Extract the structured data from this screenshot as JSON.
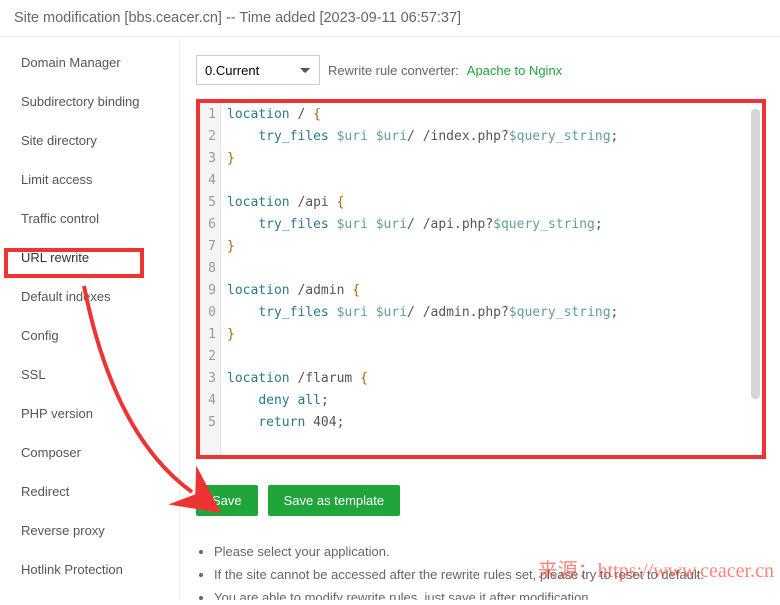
{
  "header": {
    "title": "Site modification [bbs.ceacer.cn] -- Time added [2023-09-11 06:57:37]"
  },
  "sidebar": {
    "items": [
      {
        "label": "Domain Manager"
      },
      {
        "label": "Subdirectory binding"
      },
      {
        "label": "Site directory"
      },
      {
        "label": "Limit access"
      },
      {
        "label": "Traffic control"
      },
      {
        "label": "URL rewrite"
      },
      {
        "label": "Default indexes"
      },
      {
        "label": "Config"
      },
      {
        "label": "SSL"
      },
      {
        "label": "PHP version"
      },
      {
        "label": "Composer"
      },
      {
        "label": "Redirect"
      },
      {
        "label": "Reverse proxy"
      },
      {
        "label": "Hotlink Protection"
      }
    ]
  },
  "dropdown": {
    "value": "0.Current"
  },
  "converter": {
    "label": "Rewrite rule converter: ",
    "link": "Apache to Nginx"
  },
  "code": {
    "lines": [
      {
        "n": "1",
        "raw": "location / {",
        "seg": [
          [
            "kw",
            "location"
          ],
          [
            "",
            " / "
          ],
          [
            "brace",
            "{"
          ]
        ]
      },
      {
        "n": "2",
        "raw": "    try_files $uri $uri/ /index.php?$query_string;",
        "seg": [
          [
            "",
            "    "
          ],
          [
            "kw",
            "try_files"
          ],
          [
            "",
            " "
          ],
          [
            "var",
            "$uri"
          ],
          [
            "",
            " "
          ],
          [
            "var",
            "$uri"
          ],
          [
            "",
            "/ /index.php?"
          ],
          [
            "var",
            "$query_string"
          ],
          [
            "",
            ";"
          ]
        ]
      },
      {
        "n": "3",
        "raw": "}",
        "seg": [
          [
            "brace",
            "}"
          ]
        ]
      },
      {
        "n": "4",
        "raw": "",
        "seg": [
          [
            "",
            ""
          ]
        ]
      },
      {
        "n": "5",
        "raw": "location /api {",
        "seg": [
          [
            "kw",
            "location"
          ],
          [
            "",
            " /api "
          ],
          [
            "brace",
            "{"
          ]
        ]
      },
      {
        "n": "6",
        "raw": "    try_files $uri $uri/ /api.php?$query_string;",
        "seg": [
          [
            "",
            "    "
          ],
          [
            "kw",
            "try_files"
          ],
          [
            "",
            " "
          ],
          [
            "var",
            "$uri"
          ],
          [
            "",
            " "
          ],
          [
            "var",
            "$uri"
          ],
          [
            "",
            "/ /api.php?"
          ],
          [
            "var",
            "$query_string"
          ],
          [
            "",
            ";"
          ]
        ]
      },
      {
        "n": "7",
        "raw": "}",
        "seg": [
          [
            "brace",
            "}"
          ]
        ]
      },
      {
        "n": "8",
        "raw": "",
        "seg": [
          [
            "",
            ""
          ]
        ]
      },
      {
        "n": "9",
        "raw": "location /admin {",
        "seg": [
          [
            "kw",
            "location"
          ],
          [
            "",
            " /admin "
          ],
          [
            "brace",
            "{"
          ]
        ]
      },
      {
        "n": "0",
        "raw": "    try_files $uri $uri/ /admin.php?$query_string;",
        "seg": [
          [
            "",
            "    "
          ],
          [
            "kw",
            "try_files"
          ],
          [
            "",
            " "
          ],
          [
            "var",
            "$uri"
          ],
          [
            "",
            " "
          ],
          [
            "var",
            "$uri"
          ],
          [
            "",
            "/ /admin.php?"
          ],
          [
            "var",
            "$query_string"
          ],
          [
            "",
            ";"
          ]
        ]
      },
      {
        "n": "1",
        "raw": "}",
        "seg": [
          [
            "brace",
            "}"
          ]
        ]
      },
      {
        "n": "2",
        "raw": "",
        "seg": [
          [
            "",
            ""
          ]
        ]
      },
      {
        "n": "3",
        "raw": "location /flarum {",
        "seg": [
          [
            "kw",
            "location"
          ],
          [
            "",
            " /flarum "
          ],
          [
            "brace",
            "{"
          ]
        ]
      },
      {
        "n": "4",
        "raw": "    deny all;",
        "seg": [
          [
            "",
            "    "
          ],
          [
            "kw",
            "deny"
          ],
          [
            "",
            " "
          ],
          [
            "kw",
            "all"
          ],
          [
            "",
            ";"
          ]
        ]
      },
      {
        "n": "5",
        "raw": "    return 404;",
        "seg": [
          [
            "",
            "    "
          ],
          [
            "kw",
            "return"
          ],
          [
            "",
            " 404;"
          ]
        ]
      }
    ]
  },
  "buttons": {
    "save": "Save",
    "saveTpl": "Save as template"
  },
  "notes": {
    "items": [
      "Please select your application.",
      "If the site cannot be accessed after the rewrite rules set, please try to reset to default.",
      "You are able to modify rewrite rules, just save it after modification."
    ]
  },
  "watermark": "来源：https://www.ceacer.cn"
}
